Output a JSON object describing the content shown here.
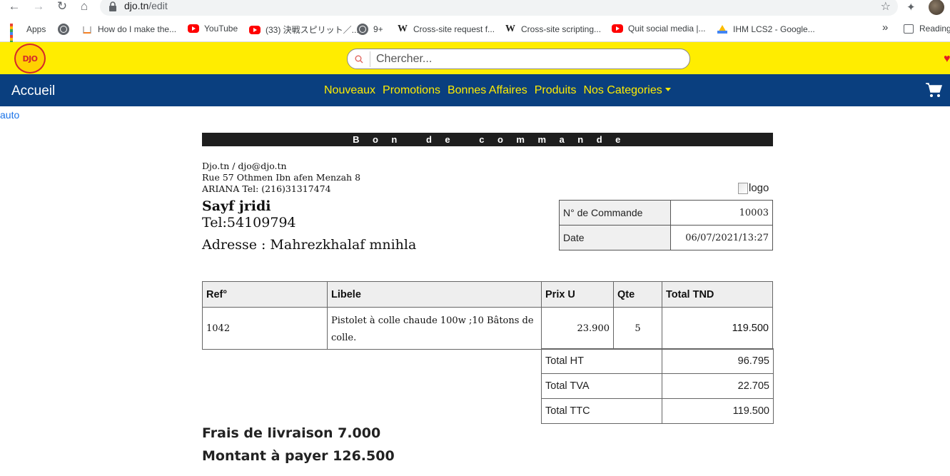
{
  "browser": {
    "url_host": "djo.tn",
    "url_path": "/edit",
    "bookmarks": [
      {
        "label": "Apps",
        "icon": "apps-grid-icon"
      },
      {
        "label": "",
        "icon": "globe-icon"
      },
      {
        "label": "How do I make the...",
        "icon": "stackoverflow-icon"
      },
      {
        "label": "YouTube",
        "icon": "youtube-icon"
      },
      {
        "label": "(33) 決戦スピリット／...",
        "icon": "youtube-icon"
      },
      {
        "label": "9+",
        "icon": "globe-icon"
      },
      {
        "label": "Cross-site request f...",
        "icon": "wikipedia-icon"
      },
      {
        "label": "Cross-site scripting...",
        "icon": "wikipedia-icon"
      },
      {
        "label": "Quit social media |...",
        "icon": "youtube-icon"
      },
      {
        "label": "IHM LCS2 - Google...",
        "icon": "google-drive-icon"
      }
    ],
    "bookmarks_more": "»",
    "reading_list": "Reading"
  },
  "site": {
    "logo_text": "DJO",
    "search_placeholder": "Chercher...",
    "brand": "Accueil",
    "menu": [
      "Nouveaux",
      "Promotions",
      "Bonnes Affaires",
      "Produits",
      "Nos Categories"
    ],
    "auto_label": "auto"
  },
  "doc": {
    "title": "Bon de commande",
    "company": {
      "line1": "Djo.tn / djo@djo.tn",
      "line2": "Rue 57 Othmen Ibn afen Menzah 8",
      "line3": "ARIANA Tel: (216)31317474"
    },
    "client": {
      "name": "Sayf jridi",
      "tel": "Tel:54109794",
      "address": "Adresse : Mahrezkhalaf mnihla"
    },
    "logo_alt": "logo",
    "order": {
      "number_label": "N° de Commande",
      "number_value": "10003",
      "date_label": "Date",
      "date_value": "06/07/2021/13:27"
    },
    "items_headers": [
      "Ref°",
      "Libele",
      "Prix U",
      "Qte",
      "Total TND"
    ],
    "items": [
      {
        "ref": "1042",
        "libele": "Pistolet à colle chaude 100w ;10 Bâtons de colle.",
        "prix": "23.900",
        "qte": "5",
        "total": "119.500"
      }
    ],
    "totals": [
      {
        "label": "Total HT",
        "value": "96.795"
      },
      {
        "label": "Total TVA",
        "value": "22.705"
      },
      {
        "label": "Total TTC",
        "value": "119.500"
      }
    ],
    "delivery": "Frais de livraison 7.000",
    "to_pay": "Montant à payer 126.500"
  }
}
